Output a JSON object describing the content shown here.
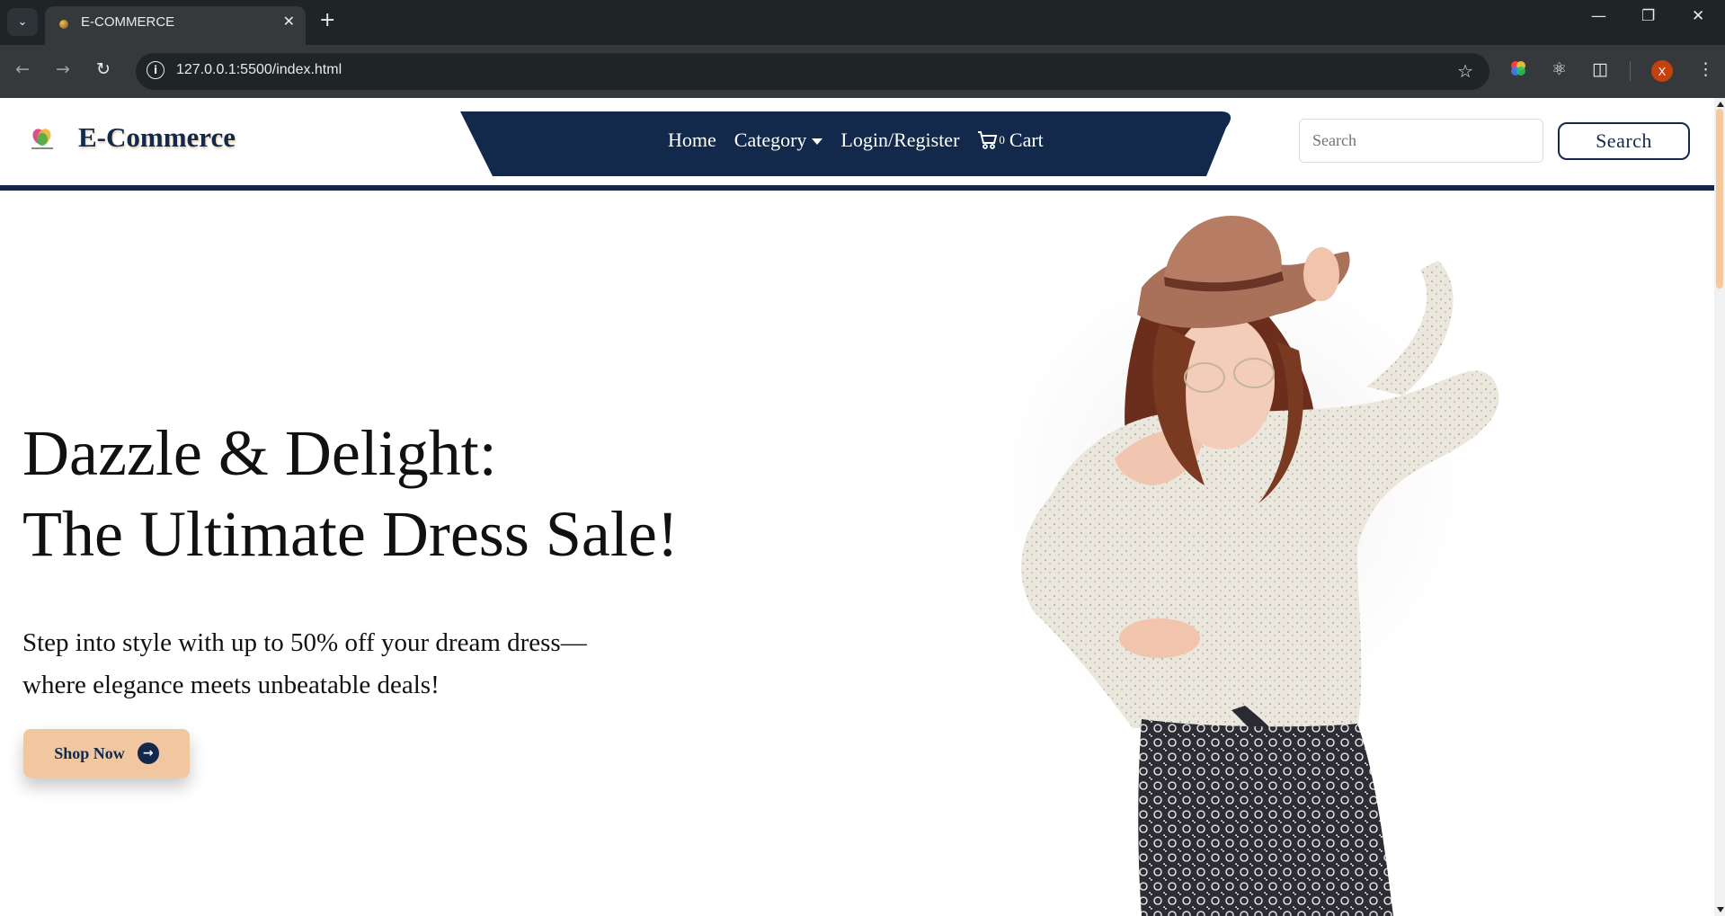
{
  "browser": {
    "tab_title": "E-COMMERCE",
    "url": "127.0.0.1:5500/index.html",
    "profile_initial": "X"
  },
  "header": {
    "brand": "E-Commerce",
    "nav": {
      "home": "Home",
      "category": "Category",
      "login": "Login/Register",
      "cart_count": "0",
      "cart": "Cart"
    },
    "search_placeholder": "Search",
    "search_button": "Search"
  },
  "hero": {
    "title_line1": "Dazzle & Delight:",
    "title_line2": "The Ultimate Dress Sale!",
    "desc_line1": "Step into style with up to 50% off your dream dress—",
    "desc_line2": "where elegance meets unbeatable deals!",
    "cta": "Shop Now"
  },
  "colors": {
    "navy": "#13294b",
    "peach": "#f0c79f"
  }
}
